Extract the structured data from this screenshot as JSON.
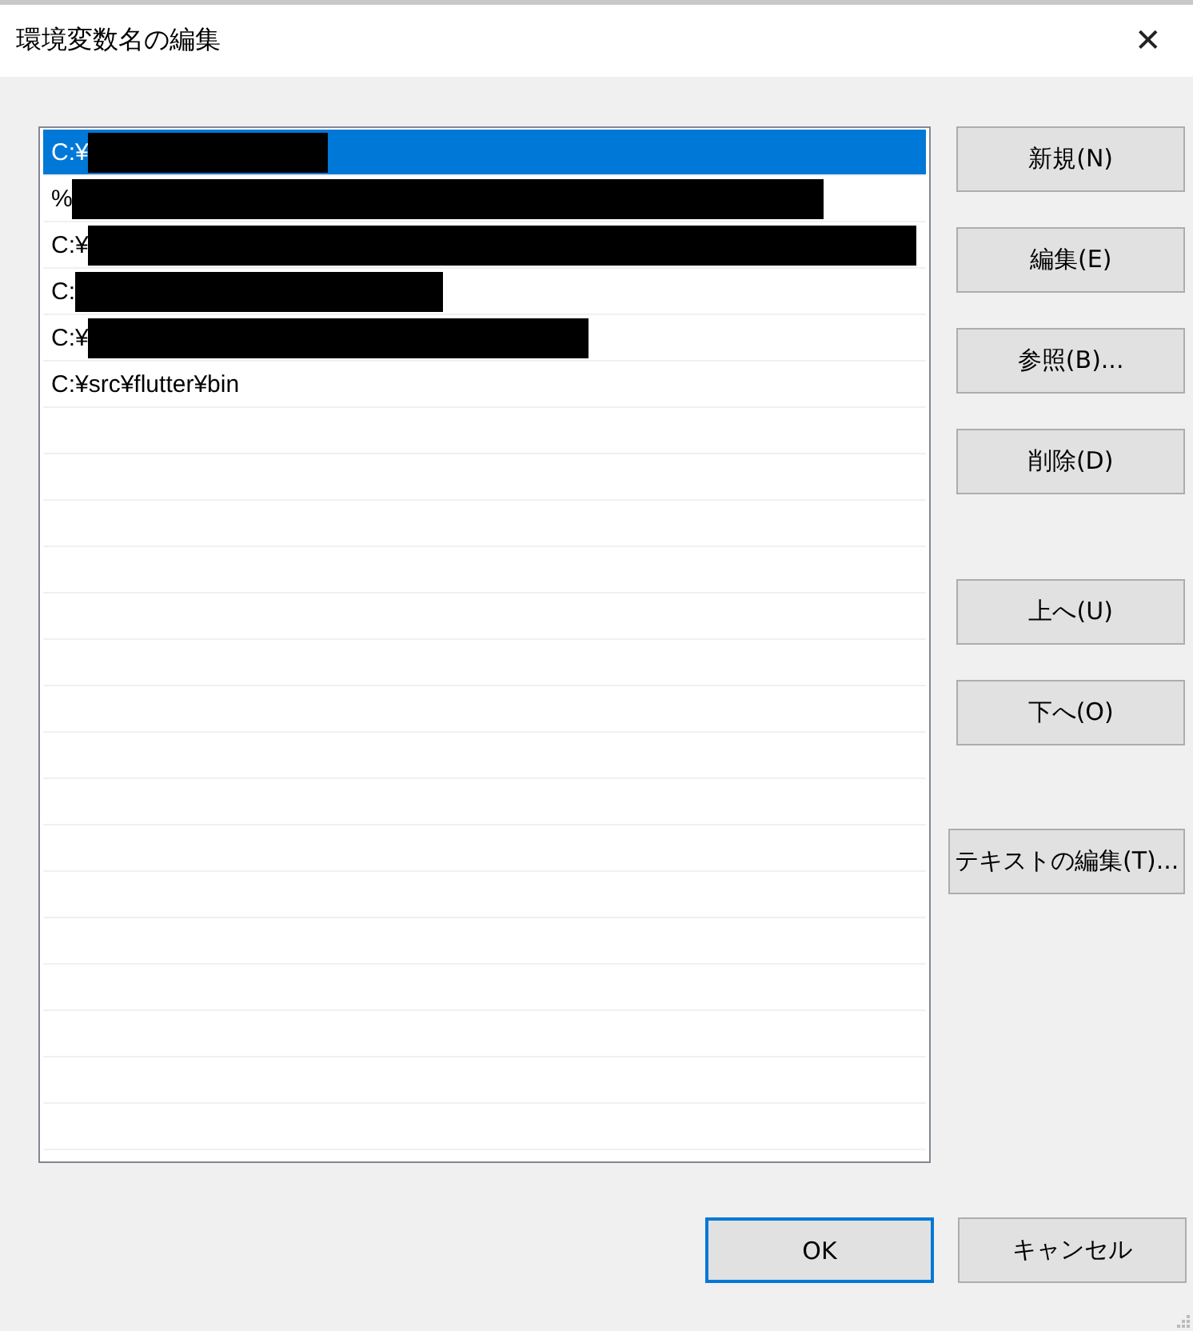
{
  "window": {
    "title": "環境変数名の編集",
    "close": "✕"
  },
  "list": {
    "items": [
      {
        "text": "C:¥",
        "selected": true,
        "redacted": true
      },
      {
        "text": "%",
        "selected": false,
        "redacted": true
      },
      {
        "text": "C:¥",
        "selected": false,
        "redacted": true
      },
      {
        "text": "C:",
        "selected": false,
        "redacted": true
      },
      {
        "text": "C:¥",
        "selected": false,
        "redacted": true
      },
      {
        "text": "C:¥src¥flutter¥bin",
        "selected": false,
        "redacted": false
      }
    ]
  },
  "button_groups": [
    [
      "新規(N)",
      "編集(E)",
      "参照(B)...",
      "削除(D)"
    ],
    [
      "上へ(U)",
      "下へ(O)"
    ],
    [
      "テキストの編集(T)..."
    ]
  ],
  "footer": [
    {
      "label": "OK",
      "default": true
    },
    {
      "label": "キャンセル",
      "default": false
    }
  ]
}
